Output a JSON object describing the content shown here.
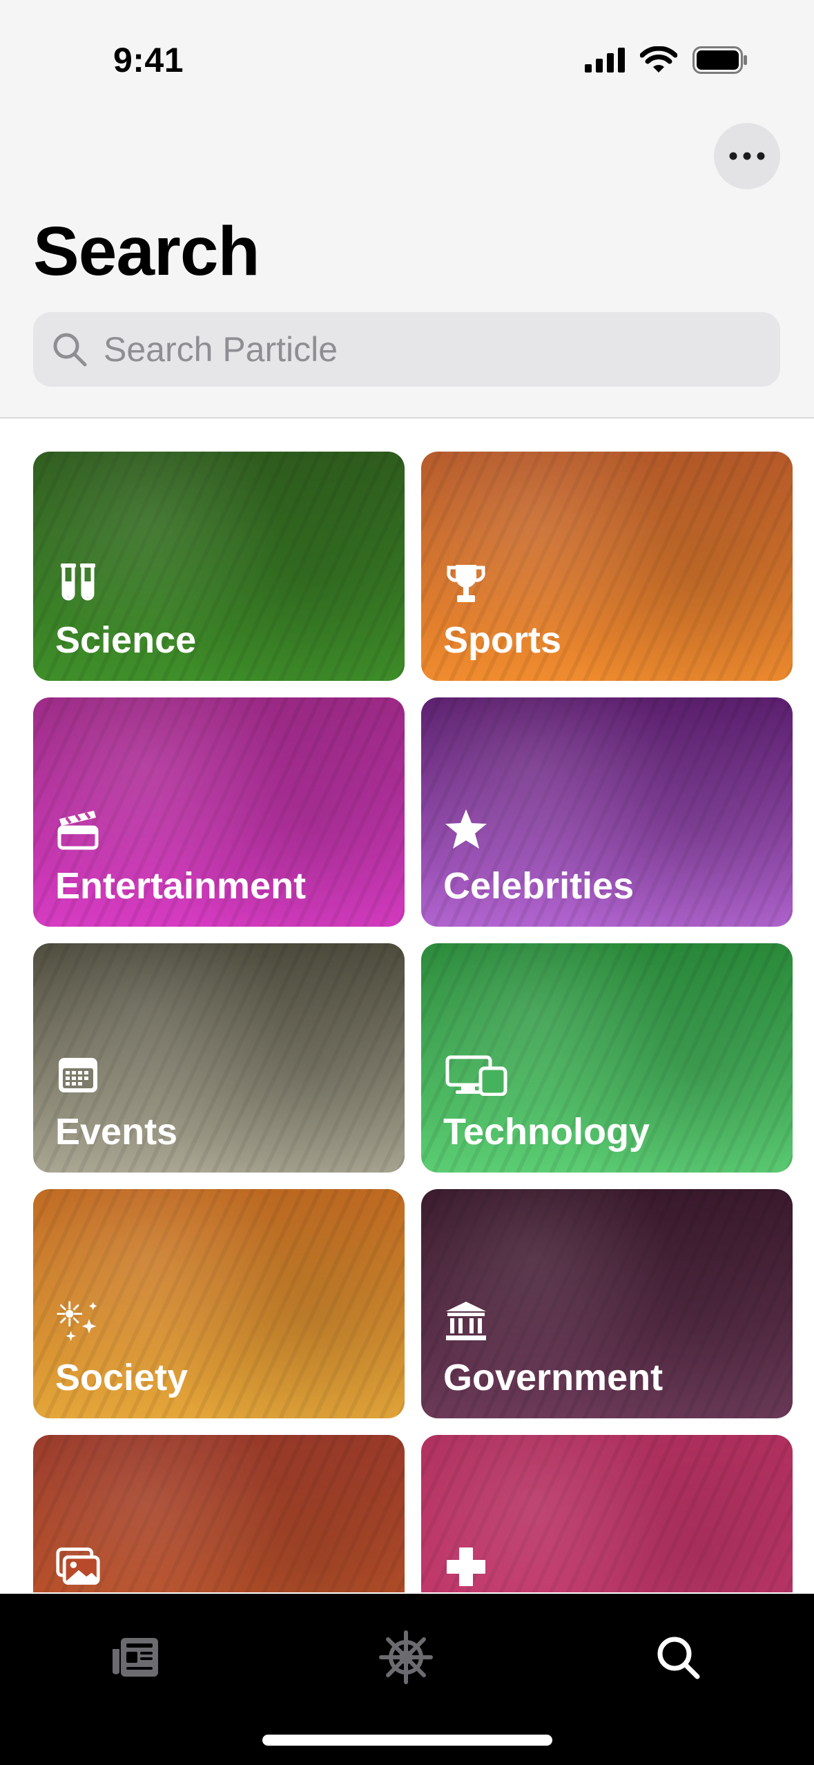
{
  "status_bar": {
    "time": "9:41"
  },
  "header": {
    "title": "Search",
    "more_icon": "ellipsis-icon"
  },
  "search": {
    "placeholder": "Search Particle",
    "value": ""
  },
  "categories": [
    {
      "label": "Science",
      "icon": "test-tubes-icon",
      "color_top": "#2f5d1e",
      "color_bottom": "#3f8f2a"
    },
    {
      "label": "Sports",
      "icon": "trophy-icon",
      "color_top": "#b65a2a",
      "color_bottom": "#f08c2f"
    },
    {
      "label": "Entertainment",
      "icon": "clapperboard-icon",
      "color_top": "#9c2a86",
      "color_bottom": "#d63cc2"
    },
    {
      "label": "Celebrities",
      "icon": "star-icon",
      "color_top": "#5c1f6e",
      "color_bottom": "#b164cf"
    },
    {
      "label": "Events",
      "icon": "calendar-icon",
      "color_top": "#4e4c3d",
      "color_bottom": "#a9a692"
    },
    {
      "label": "Technology",
      "icon": "devices-icon",
      "color_top": "#2a8a3a",
      "color_bottom": "#5ccd74"
    },
    {
      "label": "Society",
      "icon": "sparkles-icon",
      "color_top": "#c06a22",
      "color_bottom": "#e4a63a"
    },
    {
      "label": "Government",
      "icon": "building-columns-icon",
      "color_top": "#3a1a2c",
      "color_bottom": "#6b3a58"
    },
    {
      "label": "",
      "icon": "photos-icon",
      "color_top": "#9a3a2a",
      "color_bottom": "#c45a2a"
    },
    {
      "label": "",
      "icon": "plus-cross-icon",
      "color_top": "#b0305e",
      "color_bottom": "#c83b70"
    }
  ],
  "tabbar": {
    "tabs": [
      {
        "name": "news",
        "icon": "newspaper-icon",
        "active": false
      },
      {
        "name": "explore",
        "icon": "helm-icon",
        "active": false
      },
      {
        "name": "search",
        "icon": "magnifier-icon",
        "active": true
      }
    ]
  }
}
